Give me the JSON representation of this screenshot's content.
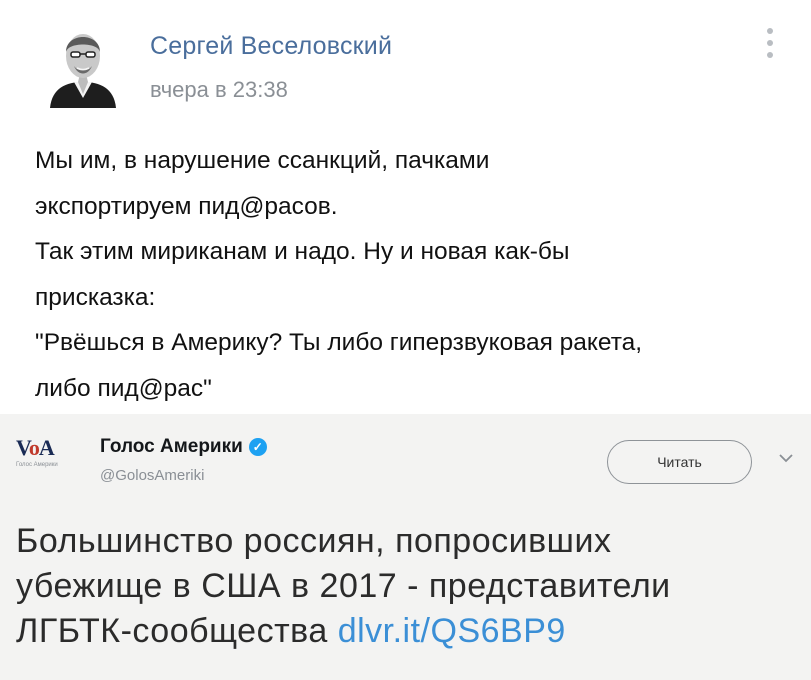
{
  "post": {
    "author": "Сергей Веселовский",
    "time": "вчера в 23:38",
    "text_lines": [
      "Мы им, в нарушение ссанкций, пачками",
      "экспортируем пид@расов.",
      "Так этим мириканам и надо. Ну и новая как-бы",
      "присказка:",
      "\"Рвёшься в Америку? Ты либо гиперзвуковая ракета,",
      "либо пид@рас\""
    ]
  },
  "embed": {
    "logo_text": "VOA",
    "logo_caption": "Голос Америки",
    "account_name": "Голос Америки",
    "handle": "@GolosAmeriki",
    "follow_label": "Читать",
    "tweet_lines": [
      "Большинство россиян, попросивших",
      "убежище в США в 2017 - представители",
      "ЛГБТК-сообщества"
    ],
    "link": "dlvr.it/QS6BP9"
  },
  "colors": {
    "author": "#4a6e9c",
    "link": "#3b8fd6",
    "verified": "#1da1f2"
  }
}
